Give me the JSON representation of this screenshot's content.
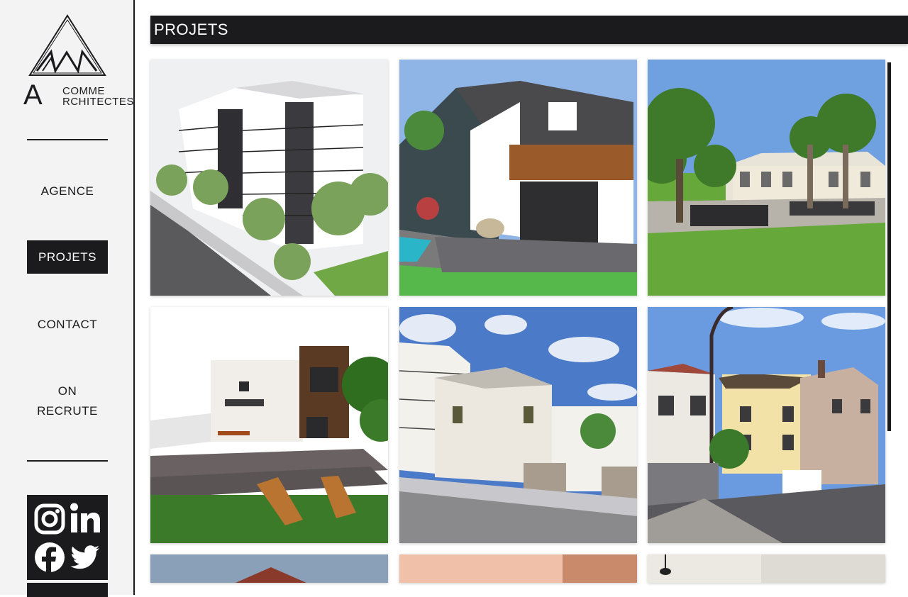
{
  "brand": {
    "letter": "A",
    "line1": "COMME",
    "line2": "RCHITECTES"
  },
  "nav": {
    "items": [
      {
        "label": "AGENCE"
      },
      {
        "label": "PROJETS"
      },
      {
        "label": "CONTACT"
      },
      {
        "label_line1": "ON",
        "label_line2": "RECRUTE"
      }
    ],
    "active_index": 1
  },
  "social": [
    "instagram-icon",
    "linkedin-icon",
    "facebook-icon",
    "twitter-icon"
  ],
  "page": {
    "title": "PROJETS"
  },
  "colors": {
    "dark": "#1b1b1d",
    "sidebar_bg": "#f3f3f3",
    "white": "#ffffff"
  },
  "projects": [
    {
      "subject": "apartment-building-render"
    },
    {
      "subject": "house-with-pool-render"
    },
    {
      "subject": "garden-terrace-photo"
    },
    {
      "subject": "modern-house-backyard-render"
    },
    {
      "subject": "street-residential-render"
    },
    {
      "subject": "street-view-photo"
    },
    {
      "subject": "sky-building-partial"
    },
    {
      "subject": "interior-peach-partial"
    },
    {
      "subject": "interior-lamp-partial"
    }
  ]
}
